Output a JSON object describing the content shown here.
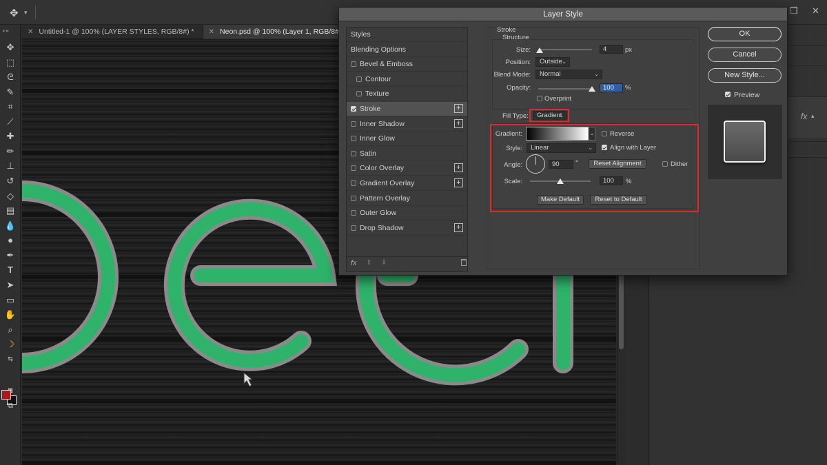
{
  "app": {
    "tabs": [
      {
        "label": "Untitled-1 @ 100% (LAYER STYLES, RGB/8#) *",
        "active": false
      },
      {
        "label": "Neon.psd @ 100% (Layer 1, RGB/8#)",
        "active": true
      }
    ]
  },
  "toolbar": {
    "tools": [
      "move-tool",
      "marquee-tool",
      "lasso-tool",
      "quick-select-tool",
      "crop-tool",
      "eyedropper-tool",
      "healing-brush-tool",
      "brush-tool",
      "clone-stamp-tool",
      "history-brush-tool",
      "eraser-tool",
      "gradient-tool",
      "blur-tool",
      "dodge-tool",
      "pen-tool",
      "type-tool",
      "path-select-tool",
      "rectangle-tool",
      "hand-tool",
      "zoom-tool",
      "banana-tool"
    ],
    "foreground_color": "#b01818",
    "background_color": "#111111"
  },
  "canvas": {
    "neon_color": "#2fb36a",
    "tube_color": "#8a8a8a"
  },
  "dialog": {
    "title": "Layer Style",
    "styles_list": [
      {
        "label": "Styles",
        "checkbox": false,
        "checked": false,
        "plus": false,
        "indent": 0
      },
      {
        "label": "Blending Options",
        "checkbox": false,
        "checked": false,
        "plus": false,
        "indent": 0
      },
      {
        "label": "Bevel & Emboss",
        "checkbox": true,
        "checked": false,
        "plus": false,
        "indent": 0
      },
      {
        "label": "Contour",
        "checkbox": true,
        "checked": false,
        "plus": false,
        "indent": 1
      },
      {
        "label": "Texture",
        "checkbox": true,
        "checked": false,
        "plus": false,
        "indent": 1
      },
      {
        "label": "Stroke",
        "checkbox": true,
        "checked": true,
        "plus": true,
        "indent": 0,
        "selected": true
      },
      {
        "label": "Inner Shadow",
        "checkbox": true,
        "checked": false,
        "plus": true,
        "indent": 0
      },
      {
        "label": "Inner Glow",
        "checkbox": true,
        "checked": false,
        "plus": false,
        "indent": 0
      },
      {
        "label": "Satin",
        "checkbox": true,
        "checked": false,
        "plus": false,
        "indent": 0
      },
      {
        "label": "Color Overlay",
        "checkbox": true,
        "checked": false,
        "plus": true,
        "indent": 0
      },
      {
        "label": "Gradient Overlay",
        "checkbox": true,
        "checked": false,
        "plus": true,
        "indent": 0
      },
      {
        "label": "Pattern Overlay",
        "checkbox": true,
        "checked": false,
        "plus": false,
        "indent": 0
      },
      {
        "label": "Outer Glow",
        "checkbox": true,
        "checked": false,
        "plus": false,
        "indent": 0
      },
      {
        "label": "Drop Shadow",
        "checkbox": true,
        "checked": false,
        "plus": true,
        "indent": 0
      }
    ],
    "footer": {
      "fx": "fx"
    },
    "stroke": {
      "section_title": "Stroke",
      "structure_title": "Structure",
      "size_label": "Size:",
      "size_value": "4",
      "size_unit": "px",
      "size_slider": 0.02,
      "position_label": "Position:",
      "position_value": "Outside",
      "blend_mode_label": "Blend Mode:",
      "blend_mode_value": "Normal",
      "opacity_label": "Opacity:",
      "opacity_value": "100",
      "opacity_unit": "%",
      "opacity_slider": 1.0,
      "overprint_label": "Overprint",
      "overprint_checked": false,
      "fill_type_label": "Fill Type:",
      "fill_type_value": "Gradient"
    },
    "gradient": {
      "gradient_label": "Gradient:",
      "reverse_label": "Reverse",
      "reverse_checked": false,
      "style_label": "Style:",
      "style_value": "Linear",
      "align_label": "Align with Layer",
      "align_checked": true,
      "angle_label": "Angle:",
      "angle_value": "90",
      "angle_unit": "°",
      "reset_alignment_label": "Reset Alignment",
      "dither_label": "Dither",
      "dither_checked": false,
      "scale_label": "Scale:",
      "scale_value": "100",
      "scale_unit": "%",
      "scale_slider": 0.5,
      "make_default_label": "Make Default",
      "reset_default_label": "Reset to Default"
    },
    "buttons": {
      "ok": "OK",
      "cancel": "Cancel",
      "new_style": "New Style...",
      "preview_label": "Preview",
      "preview_checked": true
    },
    "highlight_color": "#e02a2a"
  },
  "right_panel": {
    "fx": "fx"
  }
}
